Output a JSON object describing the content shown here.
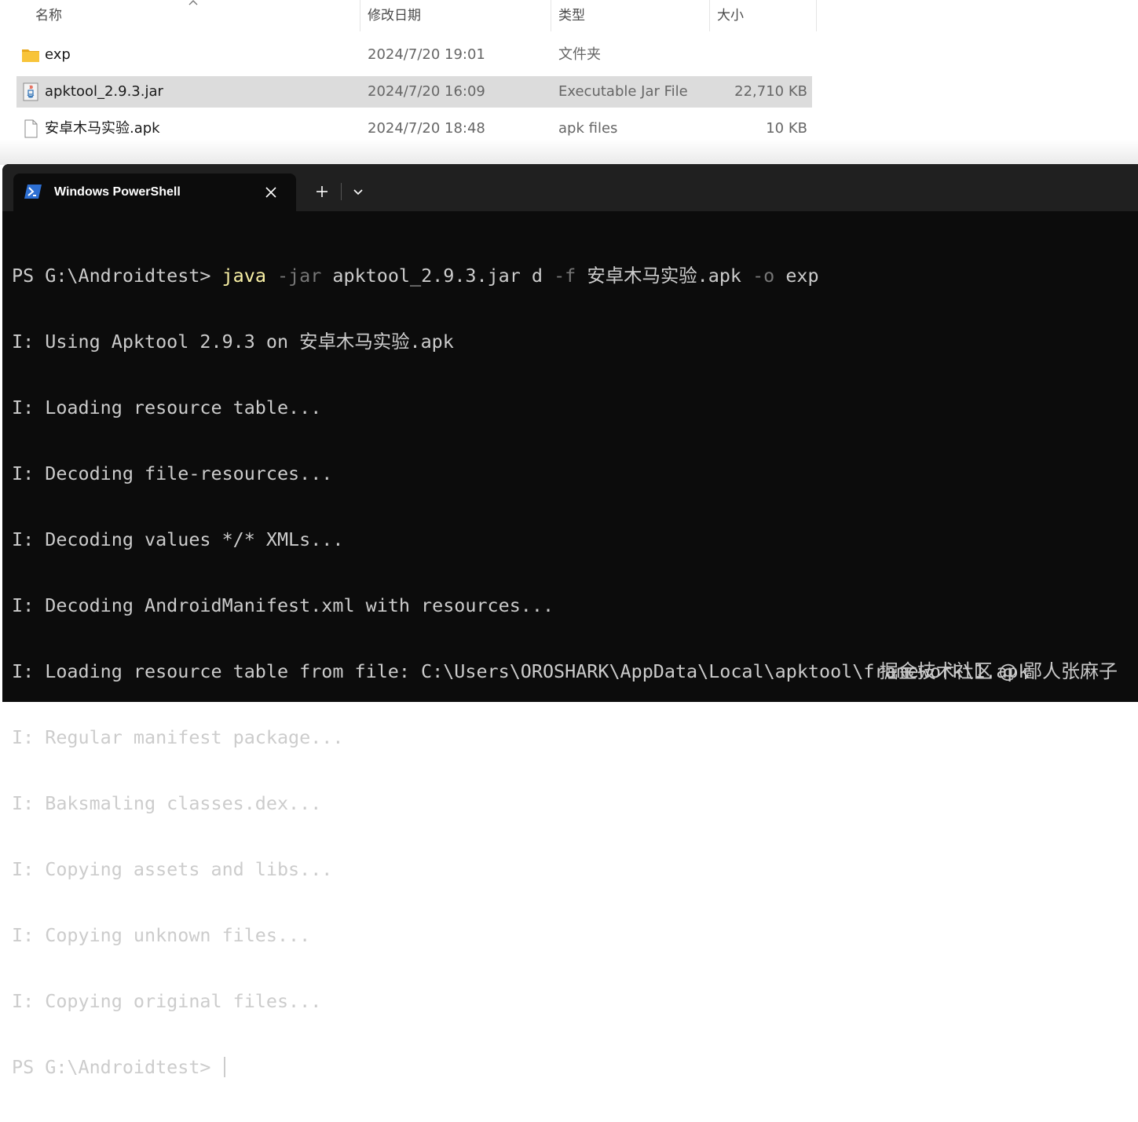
{
  "explorer": {
    "columns": {
      "name": "名称",
      "date": "修改日期",
      "type": "类型",
      "size": "大小"
    },
    "files": [
      {
        "name": "exp",
        "date": "2024/7/20 19:01",
        "type": "文件夹",
        "size": "",
        "icon": "folder-icon",
        "selected": false
      },
      {
        "name": "apktool_2.9.3.jar",
        "date": "2024/7/20 16:09",
        "type": "Executable Jar File",
        "size": "22,710 KB",
        "icon": "java-jar-icon",
        "selected": true
      },
      {
        "name": "安卓木马实验.apk",
        "date": "2024/7/20 18:48",
        "type": "apk files",
        "size": "10 KB",
        "icon": "file-icon",
        "selected": false
      }
    ]
  },
  "terminal": {
    "tab_title": "Windows PowerShell",
    "icons": {
      "tab": "powershell-icon",
      "close": "close-icon",
      "new_tab": "plus-icon",
      "dropdown": "chevron-down-icon"
    },
    "command": {
      "prompt": "PS G:\\Androidtest> ",
      "exe": "java",
      "flag_jar": " -jar",
      "arg1": " apktool_2.9.3.jar d",
      "flag_f": " -f",
      "arg2": " 安卓木马实验.apk",
      "flag_o": " -o",
      "arg3": " exp"
    },
    "output_lines": [
      "I: Using Apktool 2.9.3 on 安卓木马实验.apk",
      "I: Loading resource table...",
      "I: Decoding file-resources...",
      "I: Decoding values */* XMLs...",
      "I: Decoding AndroidManifest.xml with resources...",
      "I: Loading resource table from file: C:\\Users\\OROSHARK\\AppData\\Local\\apktool\\framework\\1.apk",
      "I: Regular manifest package...",
      "I: Baksmaling classes.dex...",
      "I: Copying assets and libs...",
      "I: Copying unknown files...",
      "I: Copying original files..."
    ],
    "final_prompt": "PS G:\\Androidtest> "
  },
  "watermark": "掘金技术社区 @ 鄙人张麻子",
  "colors": {
    "terminal_bg": "#0c0c0c",
    "tabbar_bg": "#202020",
    "text": "#cccccc",
    "command_exe": "#f9f1a5",
    "command_param": "#767676",
    "selection": "#dcdcdc",
    "folder": "#f8c43a"
  }
}
